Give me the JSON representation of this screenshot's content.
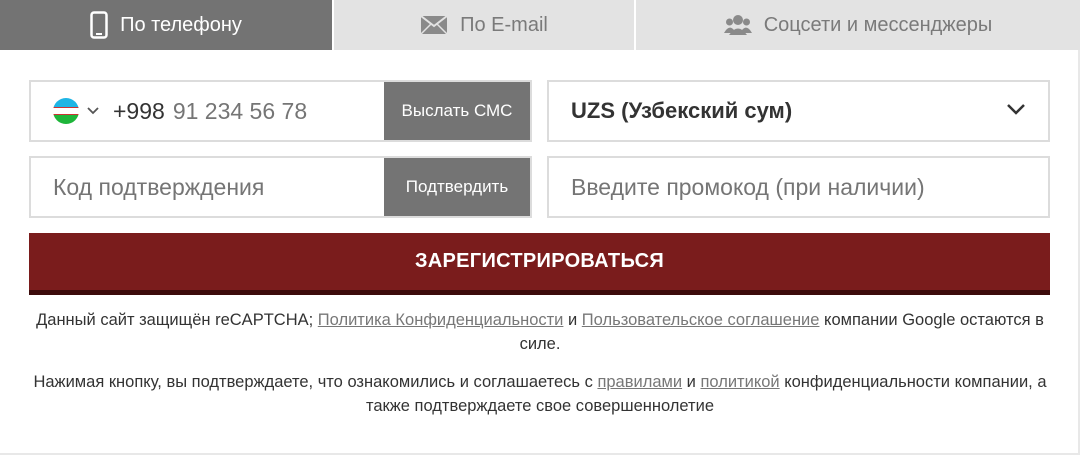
{
  "tabs": {
    "phone": {
      "label": "По телефону",
      "icon": "smartphone-icon"
    },
    "email": {
      "label": "По E-mail",
      "icon": "envelope-icon"
    },
    "social": {
      "label": "Соцсети и мессенджеры",
      "icon": "users-icon"
    }
  },
  "phone": {
    "flag": "uzbekistan-flag-icon",
    "country_code": "+998",
    "placeholder": "91 234 56 78",
    "send_button": "Выслать СМС"
  },
  "currency": {
    "selected": "UZS (Узбекский сум)"
  },
  "confirm": {
    "placeholder": "Код подтверждения",
    "button": "Подтвердить"
  },
  "promo": {
    "placeholder": "Введите промокод (при наличии)"
  },
  "register_button": "ЗАРЕГИСТРИРОВАТЬСЯ",
  "recaptcha": {
    "prefix": "Данный сайт защищён reCAPTCHA; ",
    "privacy_link": "Политика Конфиденциальности",
    "and": " и ",
    "terms_link": "Пользовательское соглашение",
    "suffix": " компании Google остаются в силе."
  },
  "agreement": {
    "prefix": "Нажимая кнопку, вы подтверждаете, что ознакомились и соглашаетесь с ",
    "rules_link": "правилами",
    "and": " и ",
    "policy_link": "политикой",
    "suffix": " конфиденциальности компании, а также подтверждаете свое совершеннолетие"
  },
  "colors": {
    "active_tab": "#737373",
    "inactive_tab": "#e3e3e3",
    "register": "#7a1c1c",
    "grey_button": "#747474"
  }
}
